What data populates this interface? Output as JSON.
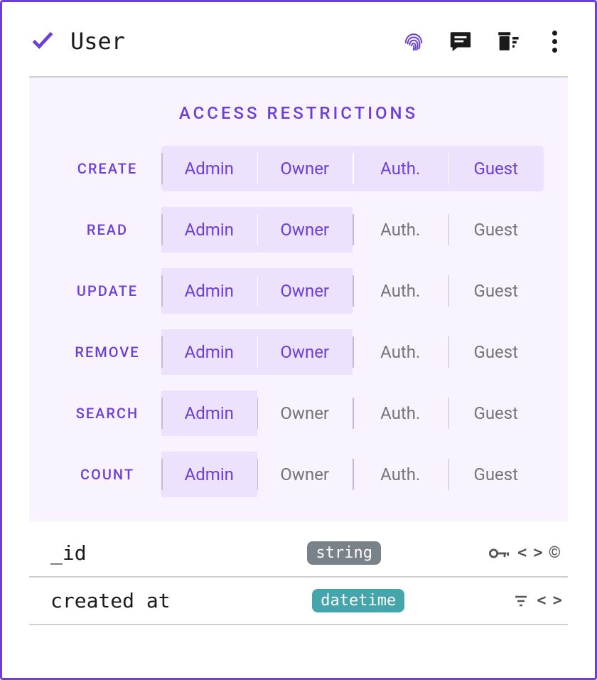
{
  "header": {
    "title": "User"
  },
  "panel": {
    "title": "ACCESS RESTRICTIONS",
    "roles": [
      "Admin",
      "Owner",
      "Auth.",
      "Guest"
    ],
    "permissions": [
      {
        "action": "CREATE",
        "granted": [
          true,
          true,
          true,
          true
        ]
      },
      {
        "action": "READ",
        "granted": [
          true,
          true,
          false,
          false
        ]
      },
      {
        "action": "UPDATE",
        "granted": [
          true,
          true,
          false,
          false
        ]
      },
      {
        "action": "REMOVE",
        "granted": [
          true,
          true,
          false,
          false
        ]
      },
      {
        "action": "SEARCH",
        "granted": [
          true,
          false,
          false,
          false
        ]
      },
      {
        "action": "COUNT",
        "granted": [
          true,
          false,
          false,
          false
        ]
      }
    ]
  },
  "fields": [
    {
      "name": "_id",
      "type": "string",
      "type_class": "type-string",
      "icons": [
        "key",
        "angle",
        "copyright"
      ]
    },
    {
      "name": "created at",
      "type": "datetime",
      "type_class": "type-datetime",
      "icons": [
        "sort",
        "angle"
      ]
    }
  ]
}
